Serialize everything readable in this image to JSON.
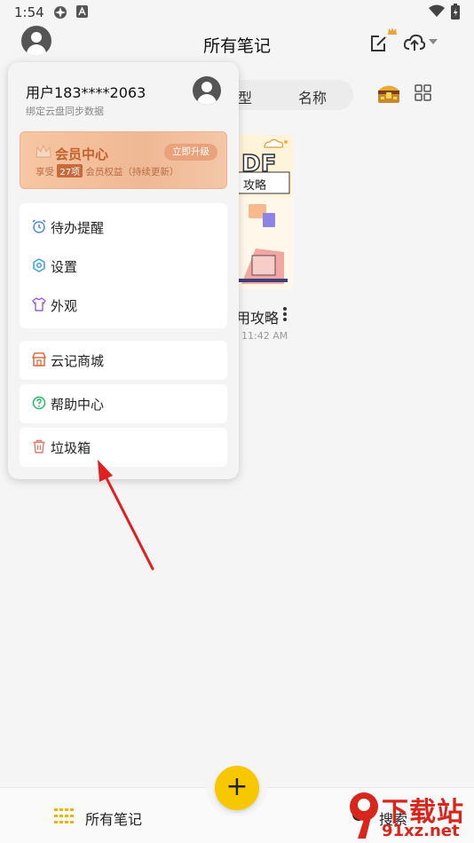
{
  "status_bar": {
    "time": "1:54"
  },
  "header": {
    "title": "所有笔记"
  },
  "background": {
    "sort_tabs": [
      "型",
      "名称"
    ],
    "note": {
      "title": "用攻略",
      "time": "11:42 AM",
      "cover_text_1": "DF",
      "cover_text_2": "攻略"
    }
  },
  "drawer": {
    "username": "用户183****2063",
    "sync_hint": "绑定云盘同步数据",
    "vip": {
      "title": "会员中心",
      "desc_prefix": "享受",
      "count": "27项",
      "desc_suffix": "会员权益（持续更新）",
      "upgrade_label": "立即升级"
    },
    "group1": [
      {
        "label": "待办提醒",
        "icon": "alarm-clock-icon"
      },
      {
        "label": "设置",
        "icon": "gear-icon"
      },
      {
        "label": "外观",
        "icon": "tshirt-icon"
      }
    ],
    "store": {
      "label": "云记商城",
      "icon": "store-icon"
    },
    "help": {
      "label": "帮助中心",
      "icon": "help-circle-icon"
    },
    "trash": {
      "label": "垃圾箱",
      "icon": "trash-icon"
    }
  },
  "bottom_bar": {
    "notes_label": "所有笔记",
    "search_label": "搜索"
  },
  "watermark": {
    "text1": "下载站",
    "text2": "91xz.net"
  },
  "colors": {
    "accent": "#f7c800",
    "vip_text": "#c4602c",
    "arrow": "#e02020"
  }
}
